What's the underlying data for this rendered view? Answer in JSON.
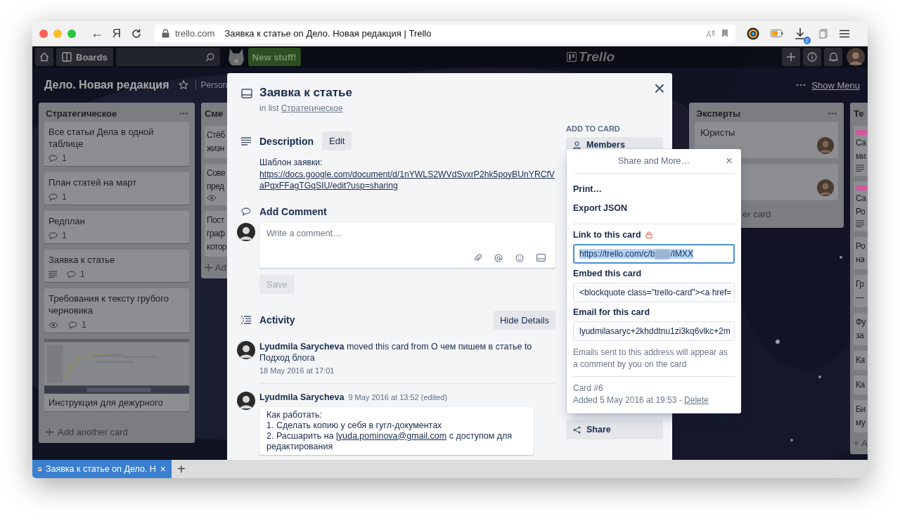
{
  "browser": {
    "back": "←",
    "yandex": "Я",
    "domain": "trello.com",
    "page_title": "Заявка к статье on Дело. Новая редакция | Trello",
    "downloads_badge": "2"
  },
  "header": {
    "boards": "Boards",
    "new_stuff": "New stuff!",
    "logo": "Trello"
  },
  "board": {
    "title": "Дело. Новая редакция",
    "starred": false,
    "visibility": "Person",
    "show_menu": "Show Menu"
  },
  "lists": [
    {
      "kind": "full",
      "title": "Стратегическое",
      "add": "Add another card",
      "cards": [
        {
          "kind": "text",
          "title": "Все статьи Дела в одной таблице",
          "description": false,
          "watching": false,
          "comments": "1"
        },
        {
          "kind": "text",
          "title": "План статей на март",
          "description": false,
          "watching": false,
          "comments": "1"
        },
        {
          "kind": "text",
          "title": "Редплан",
          "description": false,
          "watching": false,
          "comments": "1"
        },
        {
          "kind": "text",
          "title": "Заявка к статье",
          "description": true,
          "watching": false,
          "comments": "1"
        },
        {
          "kind": "text",
          "title": "Требования к тексту грубого черновика",
          "description": false,
          "watching": true,
          "comments": "1"
        },
        {
          "kind": "picture",
          "title": "Инструкция для дежурного"
        }
      ]
    },
    {
      "kind": "stub",
      "title": "Сме",
      "add": "Ad",
      "cards": [
        {
          "lines": [
            "Стёб",
            "жизн"
          ],
          "watching": false,
          "description": false
        },
        {
          "lines": [
            "Сове",
            "пред"
          ],
          "watching": true,
          "description": false
        },
        {
          "lines": [
            "Пост",
            "граф",
            "котор"
          ],
          "watching": false,
          "description": false
        }
      ]
    },
    {
      "kind": "experts",
      "title": "Эксперты",
      "add": "er card",
      "cards": [
        {
          "title": "Юристы",
          "avatar": true
        },
        {
          "avatar": true
        }
      ]
    },
    {
      "kind": "stub",
      "title": "Те",
      "add": "A",
      "cards": [
        {
          "color": "#d1589e",
          "lines": [
            "Са",
            "ми"
          ],
          "watching": false,
          "description": true
        },
        {
          "color": "#d1589e",
          "lines": [
            "Са",
            "Ро"
          ],
          "watching": false,
          "description": true
        },
        {
          "lines": [
            "Ро",
            "на"
          ],
          "watching": false,
          "description": false
        },
        {
          "lines": [
            "Гр",
            "—"
          ],
          "watching": false,
          "description": false
        },
        {
          "lines": [
            "Фу",
            "за"
          ],
          "watching": false,
          "description": false
        },
        {
          "lines": [
            "Ка"
          ],
          "watching": false,
          "description": false
        },
        {
          "lines": [
            "Ка"
          ],
          "watching": false,
          "description": false
        },
        {
          "lines": [
            "Би",
            "му"
          ],
          "watching": false,
          "description": false
        }
      ]
    }
  ],
  "card": {
    "title": "Заявка к статье",
    "in_list": "in list",
    "list_name": "Стратегическое",
    "close": "×",
    "description": {
      "heading": "Description",
      "edit": "Edit",
      "text": "Шаблон заявки:",
      "link": "https://docs.google.com/document/d/1nYWLS2WVdSvxrP2hk5poyBUnYRCfVaPqxFFagTGqSIU/edit?usp=sharing"
    },
    "comment": {
      "heading": "Add Comment",
      "placeholder": "Write a comment…",
      "save": "Save",
      "save_disabled": true
    },
    "activity": {
      "heading": "Activity",
      "toggle": "Hide Details",
      "items": [
        {
          "kind": "action",
          "text": "**Lyudmila Sarycheva** moved this card from О чем пишем в статье to Подход блога",
          "date": "18 May 2016 at 17:01"
        },
        {
          "kind": "comment",
          "author": "Lyudmila Sarycheva",
          "date": "9 May 2016 at 13:52 (edited)",
          "paragraphs": [
            {
              "kind": "text",
              "text": "Как работать:"
            },
            {
              "kind": "text",
              "text": "1. Сделать копию у себя в гугл-документах"
            },
            {
              "kind": "link",
              "before": "2. Расшарить на ",
              "link": "lyuda.pominova@gmail.com",
              "after": " с доступом для редактирования"
            }
          ]
        }
      ]
    },
    "sidebar": {
      "heading": "ADD TO CARD",
      "buttons": [
        {
          "kind": "members",
          "label": "Members"
        },
        {
          "kind": "share",
          "label": "Share"
        }
      ]
    }
  },
  "popover": {
    "title": "Share and More…",
    "close": "×",
    "actions": [
      "Print…",
      "Export JSON"
    ],
    "link": {
      "label": "Link to this card",
      "value_start": "https://trello.com/c/b",
      "value_end": "/IMXX",
      "selected": true
    },
    "embed": {
      "label": "Embed this card",
      "value": "<blockquote class=\"trello-card\"><a href="
    },
    "email": {
      "label": "Email for this card",
      "value": "lyudmilasaryc+2khddtnu1zi3kq6vlkc+2m",
      "hint": "Emails sent to this address will appear as a comment by you on the card"
    },
    "card_number": "Card #6",
    "added": "Added 5 May 2016 at 19:53 - ",
    "delete": "Delete"
  },
  "tabs": [
    {
      "label": "Заявка к статье on Дело. Н",
      "selected": true,
      "close": "×"
    }
  ],
  "new_tab": "+"
}
